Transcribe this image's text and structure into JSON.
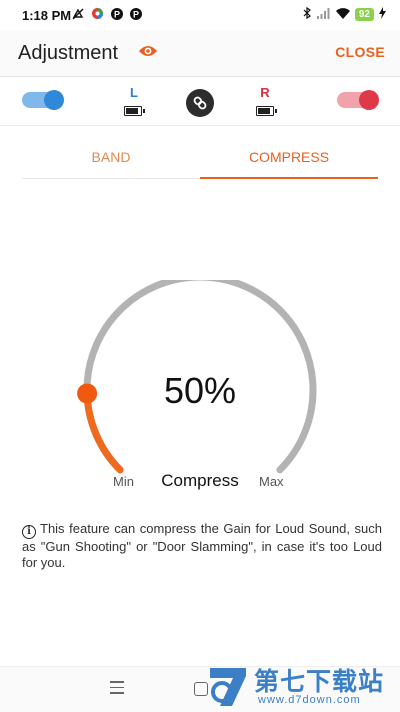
{
  "status_bar": {
    "time": "1:18 PM",
    "battery": "92",
    "left_icons": [
      "no-sync-icon",
      "color-wheel-icon",
      "p-icon",
      "p-icon"
    ],
    "right_icons": [
      "bluetooth-icon",
      "signal-icon",
      "wifi-icon",
      "battery-icon",
      "charging-icon"
    ]
  },
  "app_bar": {
    "title": "Adjustment",
    "close_label": "CLOSE",
    "accent_color": "#e8611e"
  },
  "devices": {
    "left": {
      "label": "L",
      "enabled": true,
      "color": "#2f89d8"
    },
    "right": {
      "label": "R",
      "enabled": true,
      "color": "#e0384b"
    },
    "link_icon": "link-icon"
  },
  "tabs": [
    {
      "label": "BAND",
      "active": false
    },
    {
      "label": "COMPRESS",
      "active": true
    }
  ],
  "compress": {
    "value_label": "50%",
    "value_fraction": 0.5,
    "min_label": "Min",
    "max_label": "Max",
    "title": "Compress"
  },
  "info": {
    "icon": "info-icon",
    "text": "This feature can compress the Gain for Loud Sound, such as \"Gun Shooting\" or \"Door Slamming\", in case it's too Loud for you."
  },
  "watermark": {
    "text": "第七下载站",
    "url": "www.d7down.com"
  }
}
